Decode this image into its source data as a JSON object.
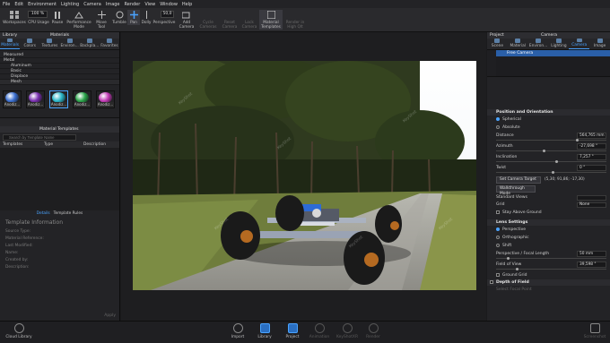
{
  "menu": [
    "File",
    "Edit",
    "Environment",
    "Lighting",
    "Camera",
    "Image",
    "Render",
    "View",
    "Window",
    "Help"
  ],
  "toolbar": {
    "workspaces": "Workspaces",
    "cpu_usage": "CPU Usage",
    "pause": "Pause",
    "perf_mode": "Performance Mode",
    "move_tool": "Move Tool",
    "tumble": "Tumble",
    "pan": "Pan",
    "dolly": "Dolly",
    "perspective": "Perspective",
    "add_camera": "Add Camera",
    "cycle_cameras": "Cycle Cameras",
    "reset_camera": "Reset Camera",
    "lock_camera": "Lock Camera",
    "material_templates": "Material Templates",
    "render_hq": "Render in High Qlt",
    "cpu_pct": "100 %",
    "fov_val": "50,0"
  },
  "left": {
    "library": "Library",
    "materials": "Materials",
    "tabs": [
      "Materials",
      "Colors",
      "Textures",
      "Environ...",
      "Backpla...",
      "Favorites"
    ],
    "tree": [
      "Measured",
      "Metal",
      "Aluminum",
      "Basic",
      "Displace",
      "Mesh"
    ],
    "swatches": [
      {
        "label": "Anodiz...",
        "color": "#3a6fd1"
      },
      {
        "label": "Anodiz...",
        "color": "#7a2fb0"
      },
      {
        "label": "Anodiz...",
        "color": "#2bb7c9"
      },
      {
        "label": "Anodiz...",
        "color": "#2aa54a"
      },
      {
        "label": "Anodiz...",
        "color": "#c23ab5"
      }
    ],
    "material_templates": "Material Templates",
    "search_placeholder": "Search by Template Name",
    "cols": [
      "Templates",
      "Type",
      "Description"
    ],
    "subtabs": [
      "Details",
      "Template Rules"
    ],
    "template_info": "Template Information",
    "fields": [
      "Source Type:",
      "Material Reference:",
      "Last Modified:",
      "Name:",
      "Created by:",
      "Description:"
    ],
    "apply": "Apply"
  },
  "right": {
    "project": "Project",
    "camera": "Camera",
    "tabs": [
      "Scene",
      "Material",
      "Environ...",
      "Lighting",
      "Camera",
      "Image"
    ],
    "free_camera": "Free Camera",
    "pos_orient": "Position and Orientation",
    "spherical": "Spherical",
    "absolute": "Absolute",
    "distance": "Distance",
    "distance_val": "564,765 mm",
    "azimuth": "Azimuth",
    "azimuth_val": "-27,698 °",
    "inclination": "Inclination",
    "inclination_val": "7,257 °",
    "twist": "Twist",
    "twist_val": "0 °",
    "set_target": "Set Camera Target",
    "target_coords": "(5,30; 91,86; -17,30)",
    "walkthrough": "Walkthrough Mode",
    "std_views": "Standard Views",
    "grid": "Grid",
    "grid_val": "None",
    "stay_above": "Stay Above Ground",
    "lens": "Lens Settings",
    "perspective": "Perspective",
    "orthographic": "Orthographic",
    "shift": "Shift",
    "persp_focal": "Perspective / Focal Length",
    "focal_val": "50 mm",
    "fov": "Field of View",
    "fov_val": "39,598 °",
    "ground_grid": "Ground Grid",
    "dof": "Depth of Field",
    "select_focal": "Select Focal Point"
  },
  "bottom": {
    "cloud_library": "Cloud Library",
    "import": "Import",
    "library": "Library",
    "project": "Project",
    "animation": "Animation",
    "keyshotxr": "KeyShotXR",
    "render": "Render",
    "screenshot": "Screenshot"
  },
  "watermark": "KeyShot"
}
